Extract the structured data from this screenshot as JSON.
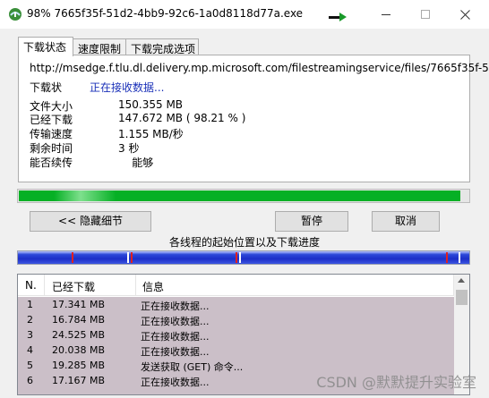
{
  "window": {
    "title": "98% 7665f35f-51d2-4bb9-92c6-1a0d8118d77a.exe"
  },
  "tabs": [
    {
      "label": "下载状态"
    },
    {
      "label": "速度限制"
    },
    {
      "label": "下载完成选项"
    }
  ],
  "status": {
    "url": "http://msedge.f.tlu.dl.delivery.mp.microsoft.com/filestreamingservice/files/7665f35f-51",
    "status_label": "下载状",
    "status_value": "正在接收数据...",
    "rows": [
      {
        "label": "文件大小",
        "value": "150.355  MB"
      },
      {
        "label": "已经下载",
        "value": "147.672  MB  ( 98.21 % )"
      },
      {
        "label": "传输速度",
        "value": "1.155  MB/秒"
      },
      {
        "label": "剩余时间",
        "value": "3 秒"
      },
      {
        "label": "能否续传",
        "value": "    能够"
      }
    ]
  },
  "progress": {
    "percent": 98.21,
    "color": "#06b025"
  },
  "buttons": {
    "hide_details": "<< 隐藏细节",
    "pause": "暂停",
    "cancel": "取消"
  },
  "threads_caption": "各线程的起始位置以及下载进度",
  "thread_list": {
    "headers": [
      "N.",
      "已经下载",
      "信息"
    ],
    "rows": [
      {
        "n": "1",
        "downloaded": "17.341  MB",
        "info": "正在接收数据..."
      },
      {
        "n": "2",
        "downloaded": "16.784  MB",
        "info": "正在接收数据..."
      },
      {
        "n": "3",
        "downloaded": "24.525  MB",
        "info": "正在接收数据..."
      },
      {
        "n": "4",
        "downloaded": "20.038  MB",
        "info": "正在接收数据..."
      },
      {
        "n": "5",
        "downloaded": "19.285  MB",
        "info": "发送获取 (GET) 命令..."
      },
      {
        "n": "6",
        "downloaded": "17.167  MB",
        "info": "正在接收数据..."
      }
    ]
  },
  "watermark": "CSDN @默默提升实验室",
  "icons": [
    "idm-app-icon",
    "speed-arrow-icon",
    "minimize-icon",
    "maximize-icon",
    "close-icon",
    "scroll-up-icon"
  ],
  "colors": {
    "status_text": "#1a30b8",
    "progress": "#06b025",
    "thread_bar": "#1d2fc8",
    "row_bg": "#cbbfc8"
  }
}
